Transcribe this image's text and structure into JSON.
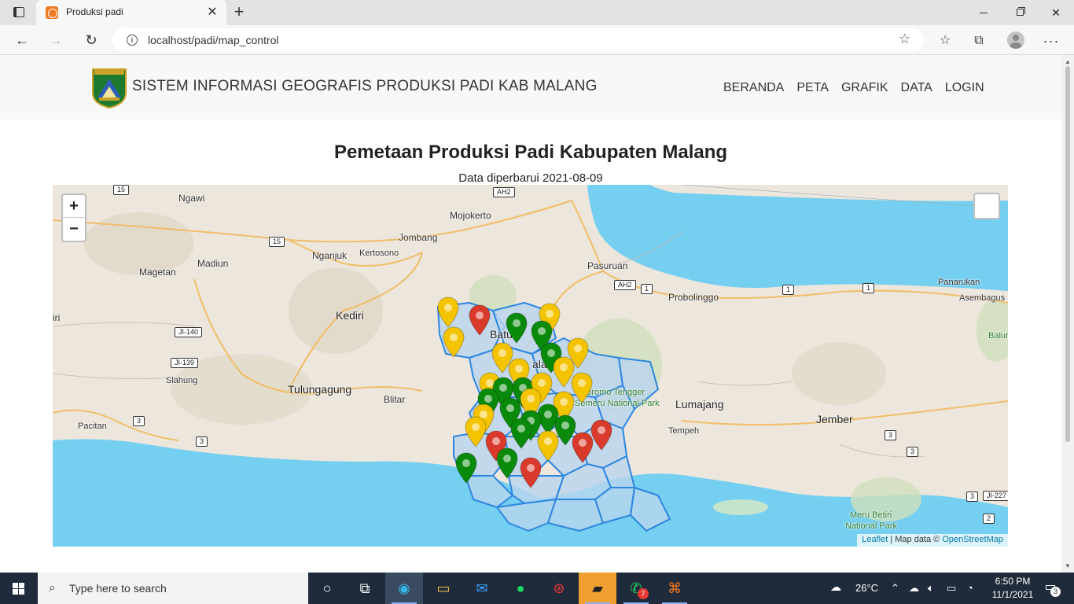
{
  "browser": {
    "tab_title": "Produksi padi",
    "url": "localhost/padi/map_control"
  },
  "site": {
    "brand": "SISTEM INFORMASI GEOGRAFIS PRODUKSI PADI KAB MALANG",
    "logo_text": "KABUPATEN MALANG",
    "nav": [
      "BERANDA",
      "PETA",
      "GRAFIK",
      "DATA",
      "LOGIN"
    ]
  },
  "page": {
    "title": "Pemetaan Produksi Padi Kabupaten Malang",
    "subtitle": "Data diperbarui 2021-08-09"
  },
  "map": {
    "zoom_in": "+",
    "zoom_out": "−",
    "attribution_leaflet": "Leaflet",
    "attribution_sep": " | Map data © ",
    "attribution_osm": "OpenStreetMap",
    "place_labels": [
      "Ngawi",
      "Mojokerto",
      "Jombang",
      "Magetan",
      "Madiun",
      "Nganjuk",
      "Kertosono",
      "Pasuruan",
      "Panarukan",
      "Probolinggo",
      "Asembagus",
      "Kediri",
      "iri",
      "Batu",
      "alang",
      "Slahung",
      "Tulungagung",
      "Blitar",
      "Bromo Tengger",
      "Semeru National Park",
      "Lumajang",
      "Jember",
      "Tempeh",
      "Pacitan",
      "Baluran",
      "Meru Betiri",
      "National Park"
    ],
    "road_shields": [
      "15",
      "AH2",
      "15",
      "AH2",
      "1",
      "1",
      "1",
      "JI-140",
      "JI-139",
      "3",
      "3",
      "3",
      "3",
      "3",
      "JI-227",
      "2"
    ],
    "marker_colors": {
      "green": "#0a8a0a",
      "yellow": "#f5c400",
      "red": "#d93a2b"
    }
  },
  "taskbar": {
    "search_placeholder": "Type here to search",
    "temperature": "26°C",
    "time": "6:50 PM",
    "date": "11/1/2021",
    "whatsapp_badge": "7",
    "notification_count": "3"
  }
}
